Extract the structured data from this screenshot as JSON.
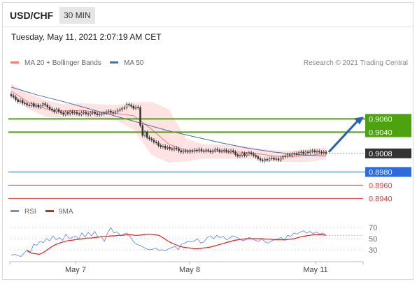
{
  "header": {
    "pair": "USD/CHF",
    "timeframe": "30 MIN"
  },
  "datetime": "Tuesday, May 11, 2021 2:07:19 AM CET",
  "legend": {
    "ma20": "MA 20 + Bollinger Bands",
    "ma50": "MA 50",
    "credit": "Research © 2021 Trading Central"
  },
  "rsi_legend": {
    "rsi": "RSI",
    "ma9": "9MA"
  },
  "colors": {
    "up": "#ffffff",
    "down": "#333333",
    "ma20": "#f08080",
    "bands": "#ffd9d9",
    "ma50": "#4a6fa5",
    "green": "#4ca30d",
    "blue": "#2e6bdc",
    "red": "#e63a3a",
    "rsi": "#6a8fe0",
    "rsi_ma": "#e02020",
    "arrow": "#2a62b3"
  },
  "chart_data": [
    {
      "type": "candlestick",
      "title": "USD/CHF 30 MIN",
      "y_range": [
        0.8932,
        0.9132
      ],
      "x_labels": [
        "May 7",
        "May 8",
        "May 11"
      ],
      "levels": [
        {
          "value": 0.906,
          "label": "0.9060",
          "kind": "resistance"
        },
        {
          "value": 0.904,
          "label": "0.9040",
          "kind": "resistance"
        },
        {
          "value": 0.9008,
          "label": "0.9008",
          "kind": "last"
        },
        {
          "value": 0.898,
          "label": "0.8980",
          "kind": "pivot"
        },
        {
          "value": 0.896,
          "label": "0.8960",
          "kind": "support"
        },
        {
          "value": 0.894,
          "label": "0.8940",
          "kind": "support"
        }
      ],
      "close": [
        0.9095,
        0.9093,
        0.9089,
        0.9086,
        0.9088,
        0.9084,
        0.9083,
        0.9081,
        0.908,
        0.9083,
        0.9079,
        0.9081,
        0.9078,
        0.908,
        0.9083,
        0.9081,
        0.9078,
        0.9075,
        0.9073,
        0.9071,
        0.9074,
        0.9071,
        0.9069,
        0.9067,
        0.907,
        0.9068,
        0.9071,
        0.9069,
        0.907,
        0.9068,
        0.9067,
        0.9069,
        0.907,
        0.9068,
        0.9067,
        0.9069,
        0.907,
        0.9068,
        0.9066,
        0.9067,
        0.9068,
        0.9069,
        0.9071,
        0.9072,
        0.907,
        0.9069,
        0.9071,
        0.9073,
        0.9074,
        0.9076,
        0.9077,
        0.9082,
        0.9081,
        0.9079,
        0.9076,
        0.9078,
        0.9077,
        0.905,
        0.9035,
        0.904,
        0.9032,
        0.903,
        0.9028,
        0.9025,
        0.9024,
        0.902,
        0.9018,
        0.9019,
        0.9016,
        0.9017,
        0.9015,
        0.9014,
        0.9016,
        0.9015,
        0.9012,
        0.901,
        0.9012,
        0.9011,
        0.901,
        0.9012,
        0.9011,
        0.9013,
        0.9012,
        0.9014,
        0.9012,
        0.9011,
        0.9013,
        0.9012,
        0.901,
        0.9012,
        0.9014,
        0.9013,
        0.9011,
        0.9012,
        0.9013,
        0.9011,
        0.901,
        0.9012,
        0.901,
        0.9006,
        0.9004,
        0.9005,
        0.9008,
        0.9005,
        0.9007,
        0.9009,
        0.9007,
        0.9005,
        0.9003,
        0.9,
        0.8998,
        0.8997,
        0.8999,
        0.8998,
        0.9,
        0.9001,
        0.8999,
        0.9,
        0.8998,
        0.9001,
        0.9003,
        0.9004,
        0.9006,
        0.9005,
        0.9007,
        0.9008,
        0.9007,
        0.9009,
        0.901,
        0.9008,
        0.901,
        0.9009,
        0.9011,
        0.9012,
        0.901,
        0.9011,
        0.901,
        0.9009,
        0.901,
        0.9008
      ],
      "ma20_bollinger": {
        "mid": [
          0.9102,
          0.9085,
          0.9075,
          0.9072,
          0.9073,
          0.907,
          0.9068,
          0.9065,
          0.9045,
          0.9022,
          0.9013,
          0.9011,
          0.901,
          0.901,
          0.9008,
          0.9004,
          0.9003,
          0.9005,
          0.9008
        ],
        "upper": [
          0.9113,
          0.9098,
          0.9088,
          0.9082,
          0.9084,
          0.9082,
          0.9081,
          0.9085,
          0.9086,
          0.9075,
          0.903,
          0.9022,
          0.9021,
          0.902,
          0.9016,
          0.9013,
          0.9012,
          0.9015,
          0.9017
        ],
        "lower": [
          0.9093,
          0.9075,
          0.9063,
          0.9062,
          0.9063,
          0.9059,
          0.9058,
          0.9044,
          0.9006,
          0.8994,
          0.8996,
          0.9,
          0.9,
          0.9,
          0.8999,
          0.8996,
          0.8995,
          0.8995,
          0.8999
        ]
      },
      "ma50": [
        0.9108,
        0.9096,
        0.9086,
        0.9075,
        0.9064,
        0.9053,
        0.9042,
        0.9033,
        0.9024,
        0.9016,
        0.901,
        0.9006,
        0.9004
      ]
    },
    {
      "type": "line",
      "title": "RSI",
      "ylim": [
        15,
        75
      ],
      "yticks": [
        70,
        50,
        30
      ],
      "series": [
        {
          "name": "RSI",
          "values": [
            20,
            22,
            20,
            18,
            24,
            30,
            26,
            40,
            38,
            45,
            43,
            50,
            46,
            55,
            48,
            52,
            47,
            58,
            50,
            52,
            55,
            49,
            60,
            53,
            61,
            55,
            63,
            52,
            54,
            45,
            60,
            70,
            60,
            62,
            55,
            58,
            60,
            54,
            45,
            40,
            38,
            35,
            32,
            30,
            31,
            33,
            29,
            30,
            28,
            32,
            34,
            36,
            30,
            40,
            42,
            45,
            44,
            46,
            50,
            42,
            44,
            52,
            55,
            50,
            56,
            52,
            54,
            48,
            51,
            55,
            53,
            50,
            46,
            48,
            52,
            50,
            47,
            45,
            50,
            44,
            42,
            46,
            48,
            50,
            52,
            47,
            56,
            54,
            60,
            58,
            62,
            64,
            60,
            63,
            59,
            62,
            58,
            60,
            56
          ]
        },
        {
          "name": "9MA",
          "values": [
            28,
            24,
            23,
            22,
            25,
            30,
            35,
            39,
            42,
            44,
            46,
            47,
            48,
            49,
            50,
            51,
            51,
            52,
            53,
            54,
            54,
            55,
            55,
            56,
            56,
            57,
            57,
            56,
            56,
            57,
            58,
            58,
            57,
            56,
            52,
            47,
            43,
            40,
            37,
            35,
            34,
            33,
            32,
            32,
            33,
            34,
            35,
            37,
            39,
            41,
            43,
            45,
            47,
            48,
            49,
            50,
            50,
            50,
            50,
            50,
            49,
            49,
            48,
            48,
            48,
            48,
            49,
            50,
            52,
            54,
            55,
            56,
            57,
            57,
            57,
            56
          ]
        }
      ]
    }
  ]
}
